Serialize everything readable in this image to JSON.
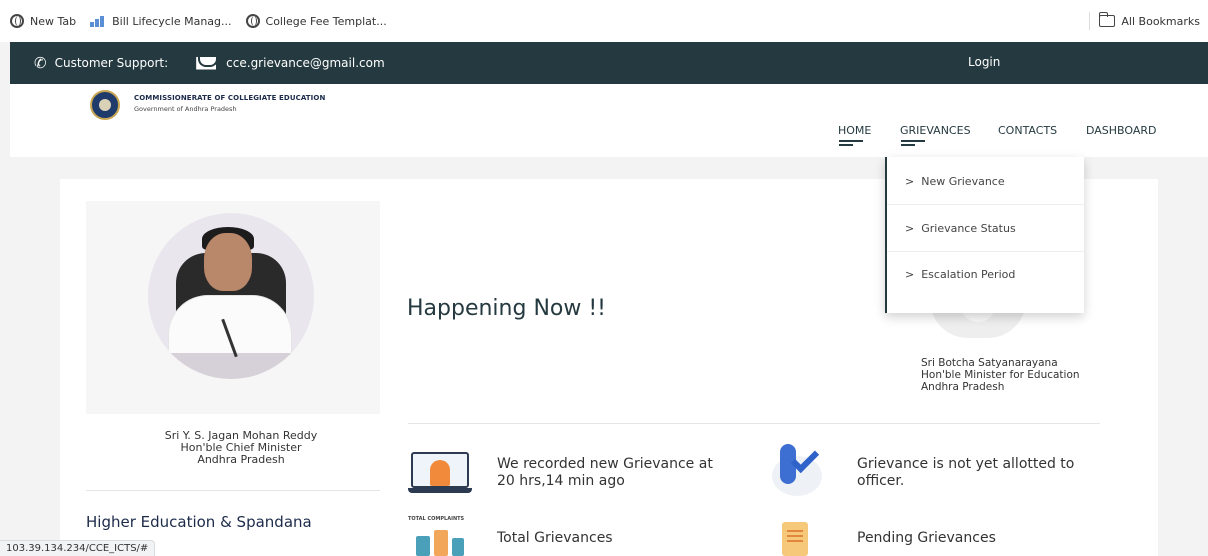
{
  "bookmarks": {
    "items": [
      {
        "label": "New Tab",
        "icon": "globe-icon"
      },
      {
        "label": "Bill Lifecycle Manag...",
        "icon": "bill-icon"
      },
      {
        "label": "College Fee Templat...",
        "icon": "globe-icon"
      }
    ],
    "all_bookmarks": "All Bookmarks"
  },
  "topbar": {
    "support_label": "Customer Support:",
    "email": "cce.grievance@gmail.com",
    "login": "Login"
  },
  "header": {
    "org_name": "COMMISSIONERATE OF COLLEGIATE EDUCATION",
    "org_sub": "Government of Andhra Pradesh",
    "nav": {
      "home": "HOME",
      "grievances": "GRIEVANCES",
      "contacts": "CONTACTS",
      "dashboard": "DASHBOARD"
    }
  },
  "dropdown": {
    "items": [
      "New Grievance",
      "Grievance Status",
      "Escalation Period"
    ],
    "chevron": ">"
  },
  "main": {
    "cm": {
      "line1": "Sri Y. S. Jagan Mohan Reddy",
      "line2": "Hon'ble Chief Minister",
      "line3": "Andhra Pradesh"
    },
    "happening": "Happening Now !!",
    "minister": {
      "line1": "Sri Botcha Satyanarayana",
      "line2": "Hon'ble Minister for Education",
      "line3": "Andhra Pradesh"
    },
    "higher_ed": "Higher Education & Spandana",
    "stats": {
      "recorded_line1": "We recorded new Grievance at",
      "recorded_line2": "20 hrs,14 min ago",
      "allotted_line1": "Grievance is not yet allotted to",
      "allotted_line2": "officer.",
      "total": "Total Grievances",
      "total_icon_label": "TOTAL COMPLAINTS",
      "pending": "Pending Grievances"
    }
  },
  "status_url": "103.39.134.234/CCE_ICTS/#"
}
